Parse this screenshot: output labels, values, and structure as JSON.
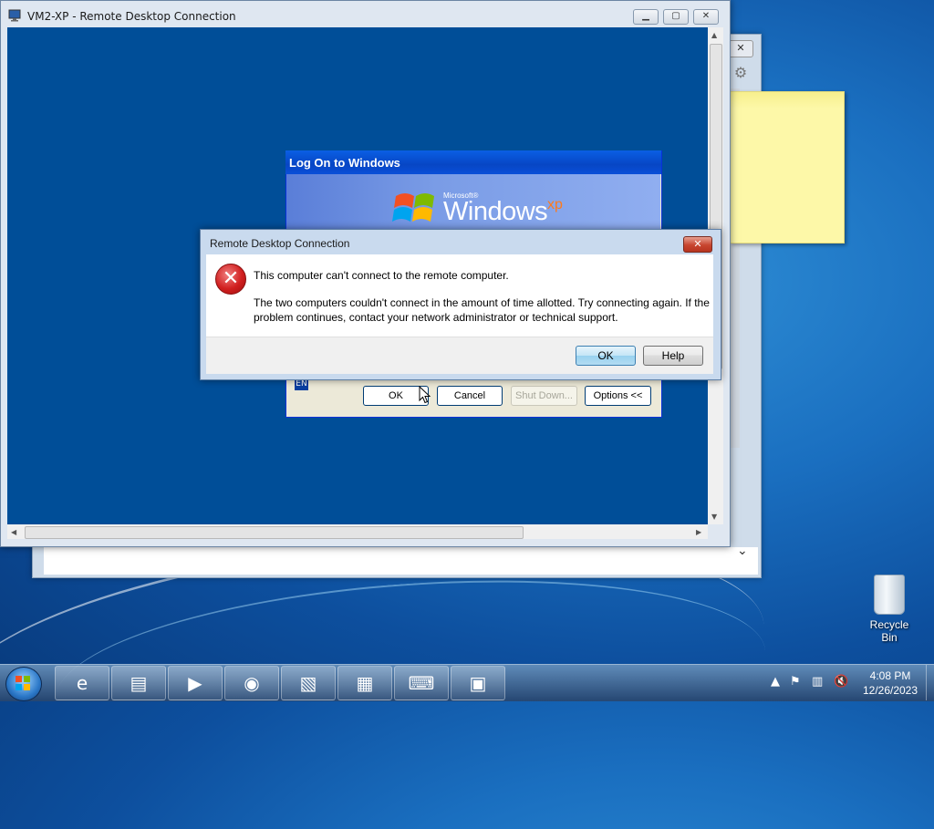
{
  "rdp_window": {
    "title": "VM2-XP - Remote Desktop Connection",
    "minimize_glyph": "▁",
    "maximize_glyph": "▢",
    "close_glyph": "✕"
  },
  "xp_logon": {
    "title": "Log On to Windows",
    "brand_small": "Microsoft®",
    "brand_main": "Windows",
    "brand_suffix": "xp",
    "language": "EN",
    "buttons": {
      "ok": "OK",
      "cancel": "Cancel",
      "shutdown": "Shut Down...",
      "options": "Options <<"
    }
  },
  "error_dialog": {
    "title": "Remote Desktop Connection",
    "icon": "error-icon",
    "icon_glyph": "✕",
    "main_instruction": "This computer can't connect to the remote computer.",
    "detail": "The two computers couldn't connect in the amount of time allotted. Try connecting again. If the problem continues, contact your network administrator or technical support.",
    "buttons": {
      "ok": "OK",
      "help": "Help"
    },
    "close_glyph": "✕"
  },
  "background_window": {
    "close_glyph": "✕",
    "gear_glyph": "⚙",
    "chevron_glyph": "⌄"
  },
  "desktop": {
    "recycle_bin_label": "Recycle Bin"
  },
  "taskbar": {
    "pinned": [
      {
        "name": "internet-explorer-icon",
        "glyph": "e"
      },
      {
        "name": "file-explorer-icon",
        "glyph": "▤"
      },
      {
        "name": "media-player-icon",
        "glyph": "▶"
      },
      {
        "name": "chrome-icon",
        "glyph": "◉"
      },
      {
        "name": "sticky-notes-icon",
        "glyph": "▧"
      },
      {
        "name": "control-panel-icon",
        "glyph": "▦"
      },
      {
        "name": "keyboard-app-icon",
        "glyph": "⌨"
      },
      {
        "name": "remote-desktop-icon",
        "glyph": "▣"
      }
    ],
    "tray_arrow": "▲",
    "tray_icons": [
      "⚑",
      "▥",
      "🔇"
    ],
    "time": "4:08 PM",
    "date": "12/26/2023"
  },
  "colors": {
    "xp_title": "#0746c5",
    "rdp_screen": "#004e98",
    "error_red": "#d11f1f",
    "sticky": "#fdf8a8"
  }
}
